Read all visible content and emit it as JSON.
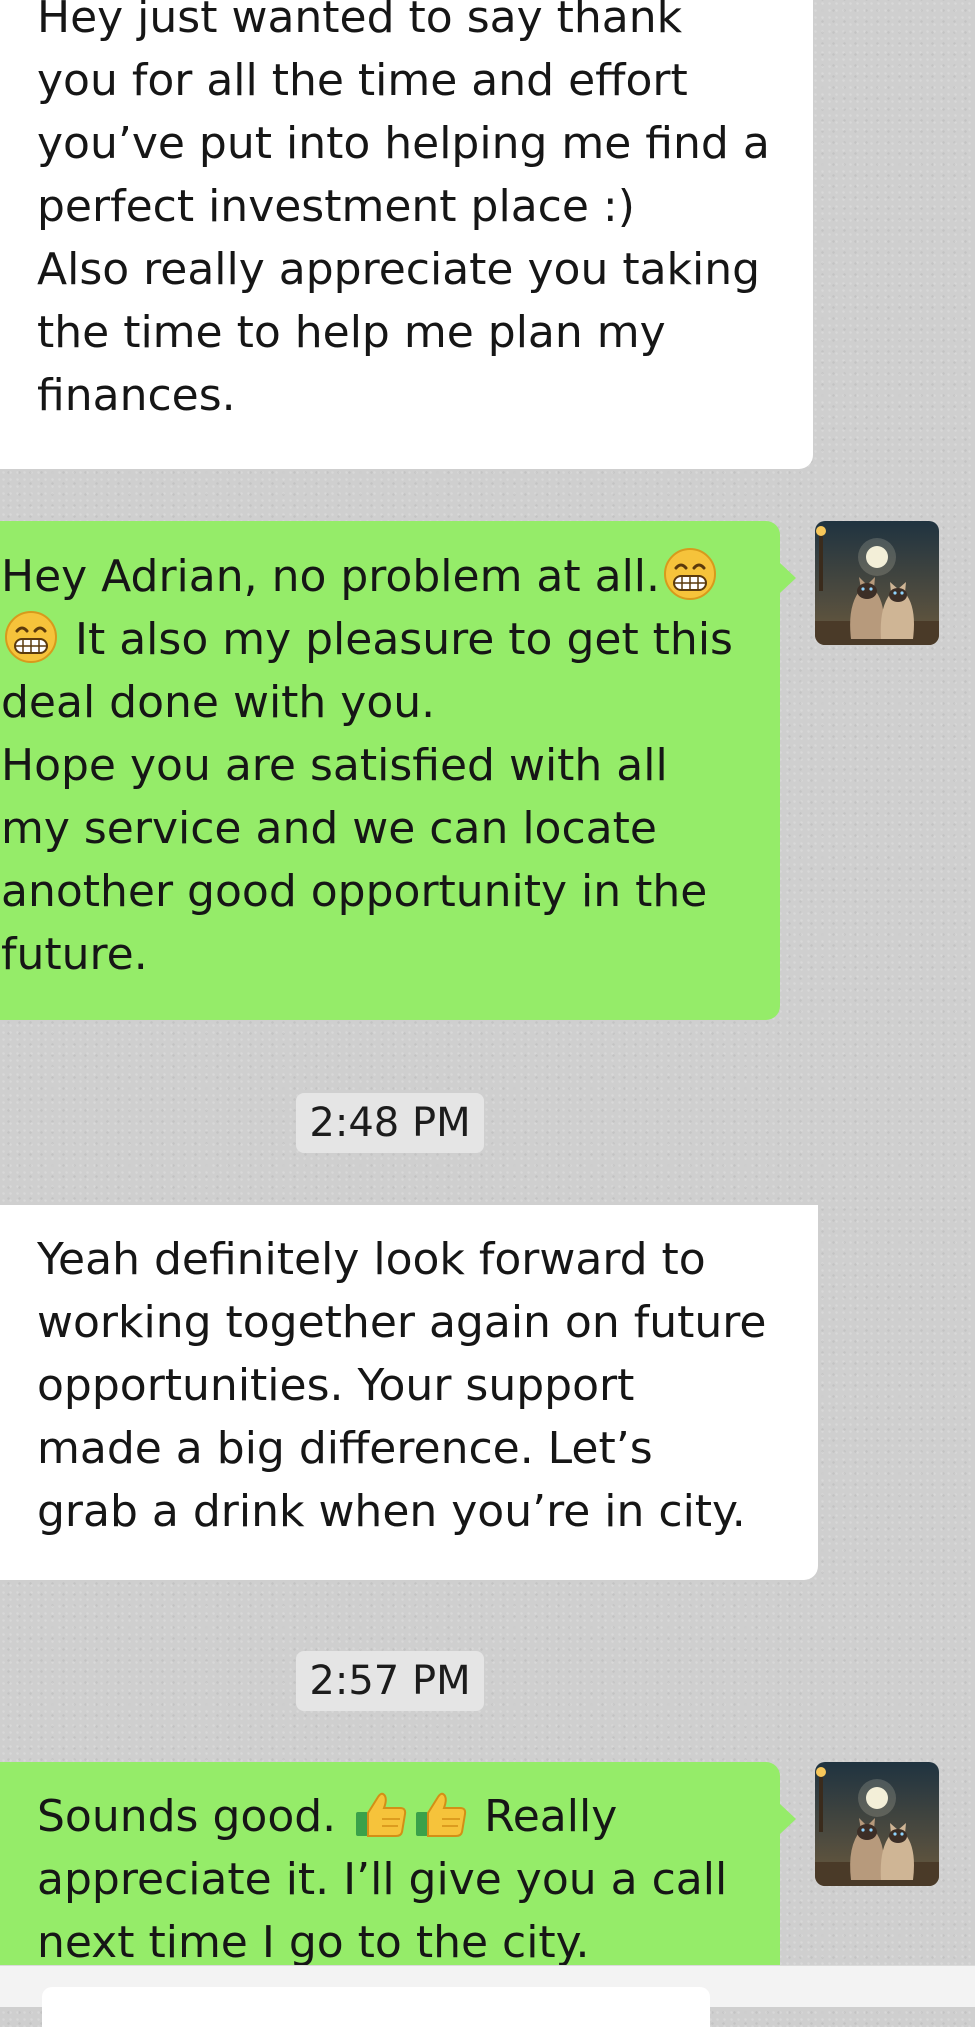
{
  "chat": {
    "messages": [
      {
        "direction": "incoming",
        "text": "Hey just wanted to say thank\nyou for all the time and effort\nyou’ve put into helping me find a\nperfect investment place :)\nAlso really appreciate you taking\nthe time to help me plan my\nfinances."
      },
      {
        "direction": "outgoing",
        "text_a": "Hey Adrian, no problem at all.",
        "emoji_a": "grinning-face-emoji",
        "emoji_b": "grinning-face-emoji",
        "text_b": " It also my pleasure to get this\ndeal done with you.\nHope you are satisfied with all\nmy service and we can locate\nanother good opportunity in the\nfuture."
      },
      {
        "direction": "incoming",
        "text": "Yeah definitely look forward to\nworking together again on future\nopportunities. Your support\nmade a big difference. Let’s\ngrab a drink when you’re in city."
      },
      {
        "direction": "outgoing",
        "text_a": "Sounds good. ",
        "emoji_a": "thumbs-up-emoji",
        "emoji_b": "thumbs-up-emoji",
        "text_b": " Really\nappreciate it. I’ll give you a call\nnext time I go to the city."
      }
    ],
    "timestamps": [
      "2:48 PM",
      "2:57 PM"
    ],
    "avatar": {
      "icon": "cats-moonlight-avatar"
    }
  },
  "colors": {
    "chat_background": "#cfcfcf",
    "incoming_bubble": "#ffffff",
    "outgoing_bubble": "#95ec69",
    "timestamp_pill": "#e5e5e5"
  }
}
